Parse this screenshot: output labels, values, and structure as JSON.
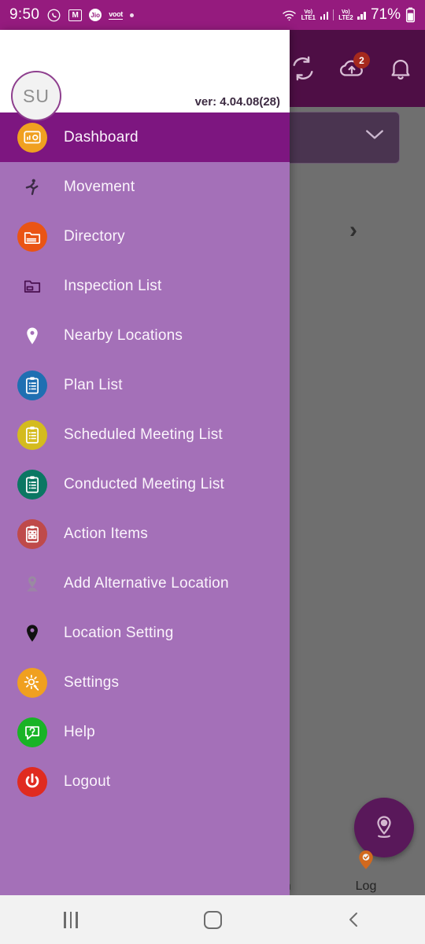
{
  "status_bar": {
    "time": "9:50",
    "battery_percent": "71%",
    "left_icons": [
      {
        "name": "whatsapp-icon",
        "glyph": "✆"
      },
      {
        "name": "gmail-icon",
        "glyph": "M"
      },
      {
        "name": "jio-icon",
        "glyph": "Jio"
      },
      {
        "name": "voot-icon",
        "glyph": "voot"
      },
      {
        "name": "more-notifications-dot",
        "glyph": "•"
      }
    ],
    "right_icons": [
      {
        "name": "wifi-icon",
        "label": ""
      },
      {
        "name": "volte-lte1-icon",
        "line1": "Vo)",
        "line2": "LTE1"
      },
      {
        "name": "signal-bars-sim1-icon",
        "label": ""
      },
      {
        "name": "volte-lte2-icon",
        "line1": "Vo)",
        "line2": "LTE2"
      },
      {
        "name": "signal-bars-sim2-icon",
        "label": ""
      },
      {
        "name": "battery-icon",
        "label": ""
      }
    ]
  },
  "app_header": {
    "sync_icon": "sync-icon",
    "cloud_upload_icon": "cloud-upload-icon",
    "cloud_upload_badge": "2",
    "notification_bell_icon": "bell-icon"
  },
  "dropdown": {
    "value": "",
    "chevron": "chevron-down-icon"
  },
  "content": {
    "expand_chevron": "›"
  },
  "fab": {
    "name": "location-pin-fab",
    "icon": "location-pin-icon"
  },
  "bottom_nav": {
    "items": [
      {
        "label": "eam",
        "full_label": "Team",
        "icon": "org-chart-icon"
      },
      {
        "label": "Log",
        "full_label": "Log",
        "icon": "location-log-icon"
      }
    ]
  },
  "drawer": {
    "avatar_initials": "SU",
    "version": "ver: 4.04.08(28)",
    "items": [
      {
        "label": "Dashboard",
        "icon": "dashboard-icon",
        "icon_bg": "#f0a020",
        "icon_fg": "#ffffff",
        "style": "circle",
        "active": true
      },
      {
        "label": "Movement",
        "icon": "movement-icon",
        "icon_bg": "",
        "icon_fg": "#3b2b45",
        "style": "plain",
        "active": false
      },
      {
        "label": "Directory",
        "icon": "folder-directory-icon",
        "icon_bg": "#ea5414",
        "icon_fg": "#ffffff",
        "style": "circle",
        "active": false
      },
      {
        "label": "Inspection List",
        "icon": "inspection-folder-icon",
        "icon_bg": "",
        "icon_fg": "#4a1050",
        "style": "plain",
        "active": false
      },
      {
        "label": "Nearby Locations",
        "icon": "map-pin-icon",
        "icon_bg": "",
        "icon_fg": "#ffffff",
        "style": "plain",
        "active": false
      },
      {
        "label": "Plan List",
        "icon": "clipboard-plan-icon",
        "icon_bg": "#1f6fb2",
        "icon_fg": "#ffffff",
        "style": "circle",
        "active": false
      },
      {
        "label": "Scheduled Meeting List",
        "icon": "clipboard-scheduled-icon",
        "icon_bg": "#d4bb1e",
        "icon_fg": "#ffffff",
        "style": "circle",
        "active": false
      },
      {
        "label": "Conducted Meeting List",
        "icon": "clipboard-conducted-icon",
        "icon_bg": "#0b7763",
        "icon_fg": "#ffffff",
        "style": "circle",
        "active": false
      },
      {
        "label": "Action Items",
        "icon": "clipboard-checklist-icon",
        "icon_bg": "#bf4a4a",
        "icon_fg": "#ffffff",
        "style": "circle",
        "active": false
      },
      {
        "label": "Add Alternative Location",
        "icon": "add-location-pin-icon",
        "icon_bg": "",
        "icon_fg": "#9a8aa2",
        "style": "plain",
        "active": false
      },
      {
        "label": "Location Setting",
        "icon": "location-pin-filled-icon",
        "icon_bg": "",
        "icon_fg": "#111111",
        "style": "plain",
        "active": false
      },
      {
        "label": "Settings",
        "icon": "gear-settings-icon",
        "icon_bg": "#f0a020",
        "icon_fg": "#ffffff",
        "style": "circle",
        "active": false
      },
      {
        "label": "Help",
        "icon": "help-question-icon",
        "icon_bg": "#19b326",
        "icon_fg": "#ffffff",
        "style": "circle",
        "active": false
      },
      {
        "label": "Logout",
        "icon": "power-logout-icon",
        "icon_bg": "#e02b20",
        "icon_fg": "#ffffff",
        "style": "circle",
        "active": false
      }
    ]
  },
  "android_nav": {
    "recents": "recents-icon",
    "home": "home-icon",
    "back": "back-icon"
  },
  "colors": {
    "status_bar_bg": "#951b7e",
    "app_header_bg": "#4e0e45",
    "drawer_bg": "#a470b8",
    "drawer_active_bg": "#7d1680",
    "dim_overlay": "#6f6f6f",
    "badge_red": "#a5291d",
    "fab_bg": "#59185a"
  }
}
